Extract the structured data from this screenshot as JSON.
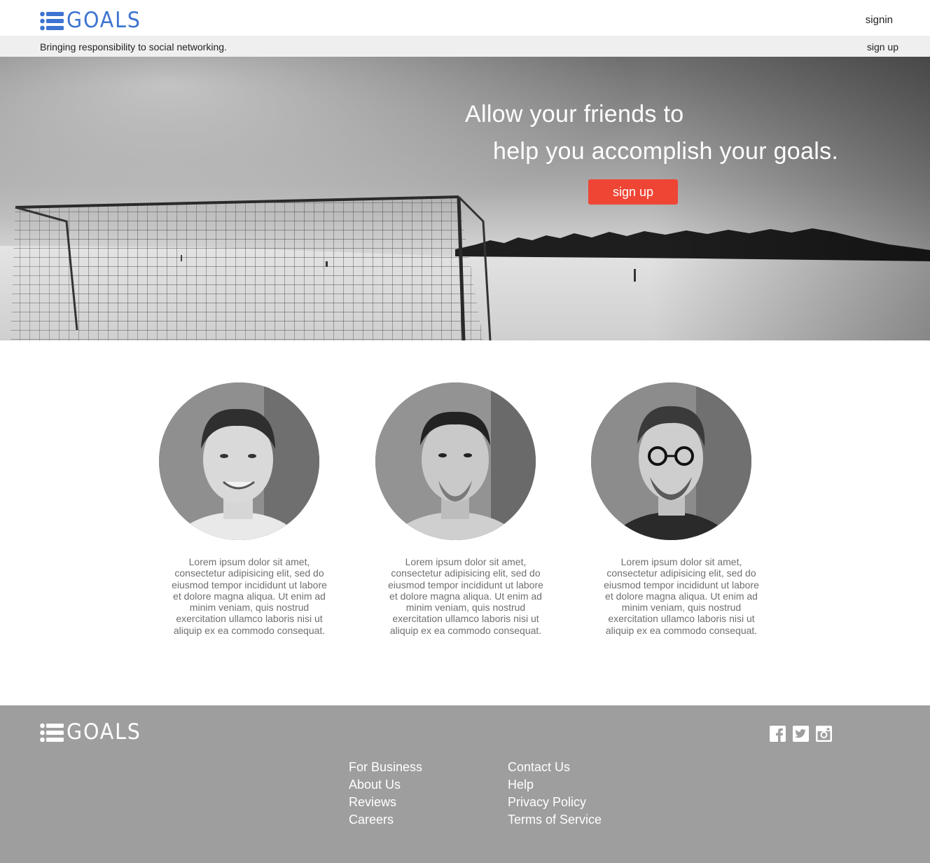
{
  "brand": {
    "name": "GOALS",
    "color": "#3d74d1",
    "icon": "list-icon"
  },
  "header": {
    "signin_label": "signin",
    "tagline": "Bringing responsibility to social networking.",
    "signup_label": "sign up"
  },
  "hero": {
    "line1": "Allow your friends to",
    "line2": "help you accomplish your goals.",
    "cta_label": "sign up",
    "cta_color": "#ef4535"
  },
  "team": [
    {
      "text": "Lorem ipsum dolor sit amet, consectetur adipisicing elit, sed do eiusmod tempor incididunt ut labore et dolore magna aliqua. Ut enim ad minim veniam, quis nostrud exercitation ullamco laboris nisi ut aliquip ex ea commodo consequat."
    },
    {
      "text": "Lorem ipsum dolor sit amet, consectetur adipisicing elit, sed do eiusmod tempor incididunt ut labore et dolore magna aliqua. Ut enim ad minim veniam, quis nostrud exercitation ullamco laboris nisi ut aliquip ex ea commodo consequat."
    },
    {
      "text": "Lorem ipsum dolor sit amet, consectetur adipisicing elit, sed do eiusmod tempor incididunt ut labore et dolore magna aliqua. Ut enim ad minim veniam, quis nostrud exercitation ullamco laboris nisi ut aliquip ex ea commodo consequat."
    }
  ],
  "footer": {
    "brand": "GOALS",
    "col1": [
      "For Business",
      "About Us",
      "Reviews",
      "Careers"
    ],
    "col2": [
      "Contact Us",
      "Help",
      "Privacy Policy",
      "Terms of Service"
    ],
    "social": [
      "facebook-icon",
      "twitter-icon",
      "instagram-icon"
    ],
    "background": "#9e9e9e"
  }
}
